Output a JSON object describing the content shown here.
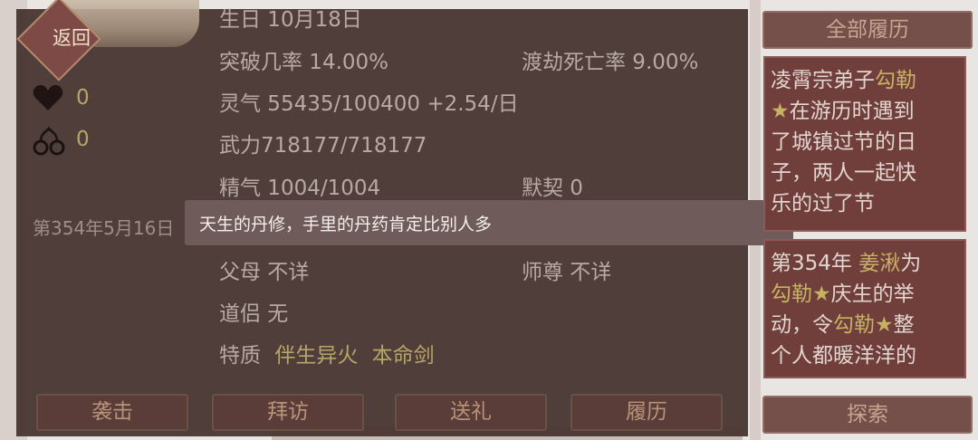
{
  "back_button": {
    "label": "返回"
  },
  "stats": {
    "birthday": "生日 10月18日",
    "breakthrough": "突破几率 14.00%",
    "tribulation": "渡劫死亡率 9.00%",
    "spirit": "灵气 55435/100400 +2.54/日",
    "force": "武力718177/718177",
    "essence": "精气 1004/1004",
    "tacit": "默契 0",
    "parents": "父母 不详",
    "master": "师尊 不详",
    "partner": "道侣 无",
    "traits_label": "特质",
    "traits": [
      "伴生异火",
      "本命剑"
    ]
  },
  "counters": {
    "heart": "0",
    "ring": "0"
  },
  "date_text": "第354年5月16日",
  "tooltip": "天生的丹修，手里的丹药肯定比别人多",
  "actions": [
    "袭击",
    "拜访",
    "送礼",
    "履历"
  ],
  "side": {
    "all_history": "全部履历",
    "explore": "探索"
  },
  "history": [
    {
      "lines": [
        [
          {
            "t": "凌霄宗弟子"
          },
          {
            "t": "勾勒",
            "hl": true
          }
        ],
        [
          {
            "t": "★",
            "hl": true
          },
          {
            "t": "在游历时遇到"
          }
        ],
        [
          {
            "t": "了城镇过节的日"
          }
        ],
        [
          {
            "t": "子，两人一起快"
          }
        ],
        [
          {
            "t": "乐的过了节"
          }
        ]
      ]
    },
    {
      "lines": [
        [
          {
            "t": "第354年 "
          },
          {
            "t": "姜湫",
            "hl": true
          },
          {
            "t": "为"
          }
        ],
        [
          {
            "t": "勾勒★",
            "hl": true
          },
          {
            "t": "庆生的举"
          }
        ],
        [
          {
            "t": "动，令"
          },
          {
            "t": "勾勒★",
            "hl": true
          },
          {
            "t": "整"
          }
        ],
        [
          {
            "t": "个人都暖洋洋的"
          }
        ]
      ]
    }
  ],
  "colors": {
    "panel": "#4a3835",
    "accent_gold": "#b7a56a",
    "card": "#703e3b"
  }
}
